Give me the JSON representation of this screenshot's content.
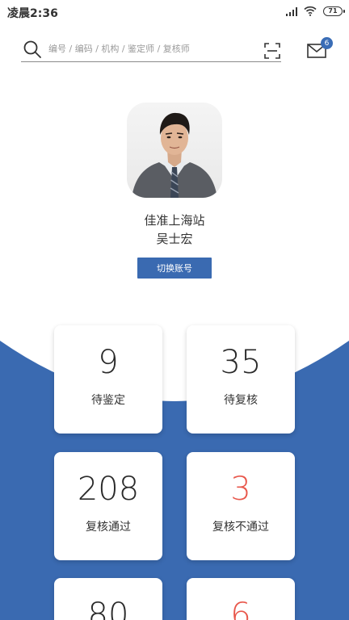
{
  "status_bar": {
    "time": "凌晨2:36",
    "battery": "71"
  },
  "search": {
    "placeholder": "编号 / 编码 / 机构 / 鉴定师 / 复核师"
  },
  "mail": {
    "badge_count": "6"
  },
  "profile": {
    "station": "佳准上海站",
    "name": "吴士宏",
    "switch_label": "切换账号"
  },
  "stats": [
    {
      "value": "9",
      "label": "待鉴定",
      "color": "#2a2a2a"
    },
    {
      "value": "35",
      "label": "待复核",
      "color": "#2a2a2a"
    },
    {
      "value": "208",
      "label": "复核通过",
      "color": "#2a2a2a"
    },
    {
      "value": "3",
      "label": "复核不通过",
      "color": "#e8574b"
    },
    {
      "value": "80",
      "label": "",
      "color": "#2a2a2a"
    },
    {
      "value": "6",
      "label": "",
      "color": "#e8574b"
    }
  ],
  "colors": {
    "primary": "#3a6ab1",
    "alert": "#e8574b"
  },
  "icons": {
    "search": "search-icon",
    "scan": "scan-icon",
    "mail": "mail-icon"
  }
}
